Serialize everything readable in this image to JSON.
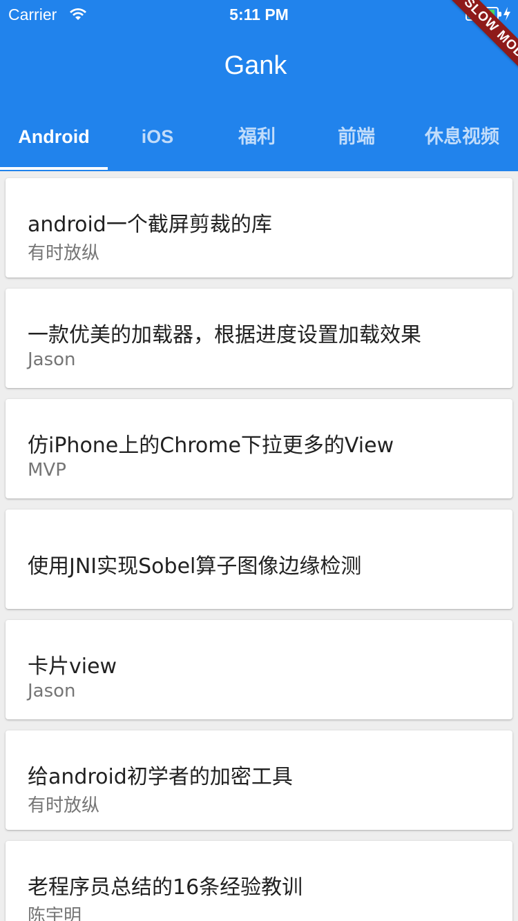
{
  "status_bar": {
    "carrier": "Carrier",
    "time": "5:11 PM",
    "wifi_icon": "wifi-icon",
    "battery_icon": "battery-icon",
    "battery_color": "#4cd964"
  },
  "debug_banner": {
    "label": "SLOW MODE",
    "color": "#8e1a1a"
  },
  "app_bar": {
    "title": "Gank",
    "background": "#2183ec",
    "tabs": [
      {
        "label": "Android",
        "selected": true
      },
      {
        "label": "iOS",
        "selected": false
      },
      {
        "label": "福利",
        "selected": false
      },
      {
        "label": "前端",
        "selected": false
      },
      {
        "label": "休息视频",
        "selected": false
      }
    ]
  },
  "list": {
    "items": [
      {
        "title": "android一个截屏剪裁的库",
        "author": "有时放纵"
      },
      {
        "title": "一款优美的加载器，根据进度设置加载效果",
        "author": "Jason"
      },
      {
        "title": "仿iPhone上的Chrome下拉更多的View",
        "author": "MVP"
      },
      {
        "title": "使用JNI实现Sobel算子图像边缘检测",
        "author": ""
      },
      {
        "title": "卡片view",
        "author": "Jason"
      },
      {
        "title": "给android初学者的加密工具",
        "author": "有时放纵"
      },
      {
        "title": "老程序员总结的16条经验教训",
        "author": "陈宇明"
      }
    ]
  }
}
